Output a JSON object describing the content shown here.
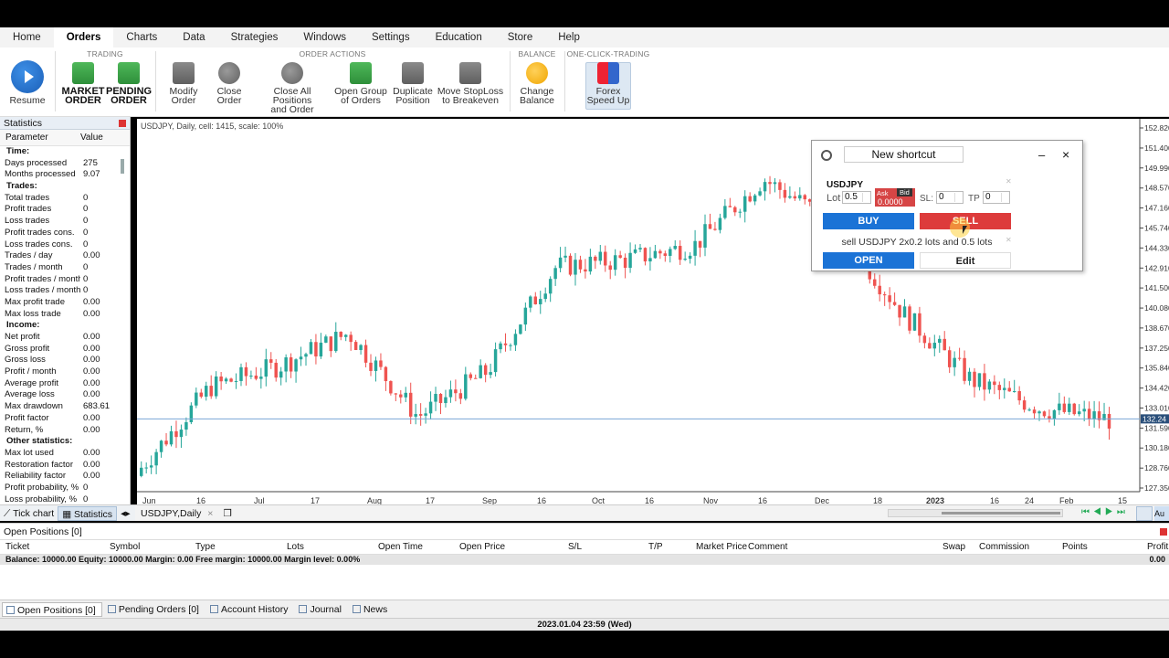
{
  "menu": [
    "Home",
    "Orders",
    "Charts",
    "Data",
    "Strategies",
    "Windows",
    "Settings",
    "Education",
    "Store",
    "Help"
  ],
  "ribbon": {
    "resume": "Resume",
    "trading_title": "TRADING",
    "market_order": [
      "MARKET",
      "ORDER"
    ],
    "pending_order": [
      "PENDING",
      "ORDER"
    ],
    "order_actions_title": "ORDER ACTIONS",
    "modify_order": [
      "Modify",
      "Order"
    ],
    "close_order": [
      "Close",
      "Order"
    ],
    "close_all": [
      "Close All Positions",
      "and Order"
    ],
    "open_group": [
      "Open Group",
      "of Orders"
    ],
    "duplicate": [
      "Duplicate",
      "Position"
    ],
    "move_stoploss": [
      "Move StopLoss",
      "to Breakeven"
    ],
    "balance_title": "BALANCE",
    "change_balance": [
      "Change",
      "Balance"
    ],
    "oct_title": "ONE-CLICK-TRADING",
    "forex_speed_up": [
      "Forex",
      "Speed Up"
    ]
  },
  "statistics": {
    "title": "Statistics",
    "col_param": "Parameter",
    "col_value": "Value",
    "rows": [
      {
        "k": "Time:",
        "v": "",
        "section": true
      },
      {
        "k": "Days processed",
        "v": "275"
      },
      {
        "k": "Months processed",
        "v": "9.07"
      },
      {
        "k": "Trades:",
        "v": "",
        "section": true
      },
      {
        "k": "Total trades",
        "v": "0"
      },
      {
        "k": "Profit trades",
        "v": "0"
      },
      {
        "k": "Loss trades",
        "v": "0"
      },
      {
        "k": "Profit trades cons.",
        "v": "0"
      },
      {
        "k": "Loss trades cons.",
        "v": "0"
      },
      {
        "k": "Trades / day",
        "v": "0.00"
      },
      {
        "k": "Trades / month",
        "v": "0"
      },
      {
        "k": "Profit trades / month",
        "v": "0"
      },
      {
        "k": "Loss trades / month",
        "v": "0"
      },
      {
        "k": "Max profit trade",
        "v": "0.00"
      },
      {
        "k": "Max loss trade",
        "v": "0.00"
      },
      {
        "k": "Income:",
        "v": "",
        "section": true
      },
      {
        "k": "Net profit",
        "v": "0.00"
      },
      {
        "k": "Gross profit",
        "v": "0.00"
      },
      {
        "k": "Gross loss",
        "v": "0.00"
      },
      {
        "k": "Profit / month",
        "v": "0.00"
      },
      {
        "k": "Average profit",
        "v": "0.00"
      },
      {
        "k": "Average loss",
        "v": "0.00"
      },
      {
        "k": "Max drawdown",
        "v": "683.61"
      },
      {
        "k": "Profit factor",
        "v": "0.00"
      },
      {
        "k": "Return, %",
        "v": "0.00"
      },
      {
        "k": "Other statistics:",
        "v": "",
        "section": true
      },
      {
        "k": "Max lot used",
        "v": "0.00"
      },
      {
        "k": "Restoration factor",
        "v": "0.00"
      },
      {
        "k": "Reliability factor",
        "v": "0.00"
      },
      {
        "k": "Profit probability, %",
        "v": "0"
      },
      {
        "k": "Loss probability, %",
        "v": "0"
      }
    ]
  },
  "left_tabs": {
    "tick_chart": "Tick chart",
    "statistics": "Statistics"
  },
  "chart": {
    "info": "USDJPY, Daily, cell: 1415, scale: 100%",
    "tab": "USDJPY,Daily",
    "price_labels": [
      "152.820",
      "151.400",
      "149.990",
      "148.570",
      "147.160",
      "145.740",
      "144.330",
      "142.910",
      "141.500",
      "140.080",
      "138.670",
      "137.250",
      "135.840",
      "134.420",
      "133.010",
      "131.590",
      "130.180",
      "128.760",
      "127.350"
    ],
    "current_price": "132.24",
    "date_labels": [
      "Jun",
      "16",
      "Jul",
      "17",
      "Aug",
      "17",
      "Sep",
      "16",
      "Oct",
      "16",
      "Nov",
      "16",
      "Dec",
      "18",
      "2023",
      "16",
      "24",
      "Feb",
      "15"
    ],
    "right_btn": "Au",
    "colors": {
      "up": "#26a69a",
      "down": "#ef5350"
    }
  },
  "chart_data": {
    "type": "candlestick",
    "title": "USDJPY, Daily",
    "x": [
      "Jun",
      "16",
      "Jul",
      "17",
      "Aug",
      "17",
      "Sep",
      "16",
      "Oct",
      "16",
      "Nov",
      "16",
      "Dec",
      "18",
      "2023"
    ],
    "y_label_range": [
      127.35,
      152.82
    ],
    "anchor_points": [
      {
        "x": "Jun",
        "close": 128.8
      },
      {
        "x": "16",
        "close": 134.5
      },
      {
        "x": "Jul",
        "close": 136.0
      },
      {
        "x": "17",
        "close": 138.3
      },
      {
        "x": "Aug",
        "close": 132.4
      },
      {
        "x": "17",
        "close": 135.6
      },
      {
        "x": "Sep",
        "close": 143.0
      },
      {
        "x": "16",
        "close": 143.5
      },
      {
        "x": "Oct",
        "close": 144.5
      },
      {
        "x": "16",
        "close": 149.2
      },
      {
        "x": "Nov",
        "close": 146.2
      },
      {
        "x": "16",
        "close": 139.8
      },
      {
        "x": "Dec",
        "close": 135.0
      },
      {
        "x": "18",
        "close": 133.0
      },
      {
        "x": "2023",
        "close": 132.2
      }
    ]
  },
  "dialog": {
    "name": "New shortcut",
    "symbol": "USDJPY",
    "lot_label": "Lot",
    "lot_value": "0.5",
    "ask": "Ask",
    "bid": "Bid",
    "price": "0.0000",
    "sl_label": "SL:",
    "sl_value": "0",
    "tp_label": "TP",
    "tp_value": "0",
    "buy": "BUY",
    "sell": "SELL",
    "description": "sell USDJPY 2x0.2 lots and 0.5 lots",
    "open": "OPEN",
    "edit": "Edit"
  },
  "open_positions": {
    "title": "Open Positions [0]",
    "columns": [
      "Ticket",
      "Symbol",
      "Type",
      "Lots",
      "Open Time",
      "Open Price",
      "S/L",
      "T/P",
      "Market Price",
      "Comment",
      "Swap",
      "Commission",
      "Points",
      "Profit"
    ],
    "balance_line": "Balance: 10000.00 Equity: 10000.00 Margin: 0.00 Free margin: 10000.00 Margin level: 0.00%",
    "balance_profit": "0.00"
  },
  "bottom_tabs": [
    "Open Positions [0]",
    "Pending Orders [0]",
    "Account History",
    "Journal",
    "News"
  ],
  "status": "2023.01.04 23:59 (Wed)"
}
